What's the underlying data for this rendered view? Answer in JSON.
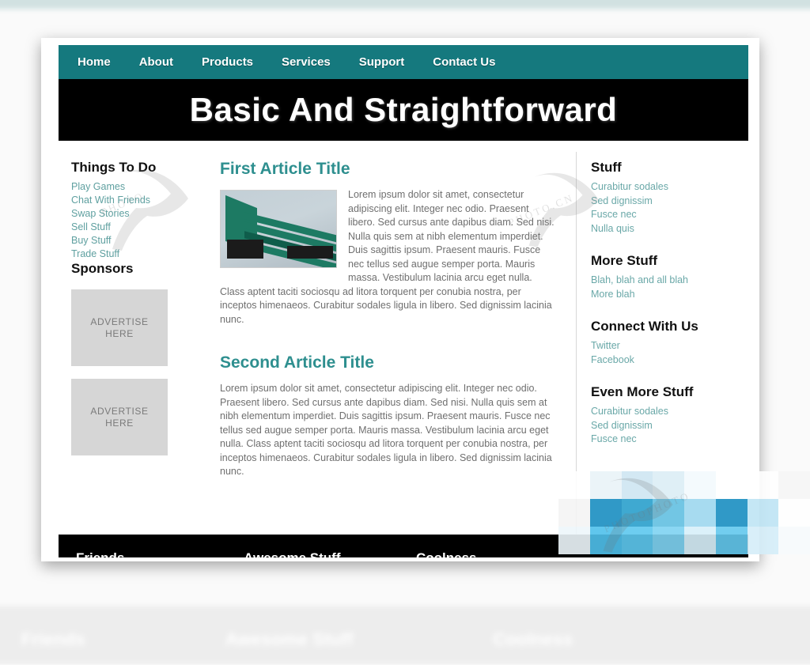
{
  "nav": {
    "items": [
      {
        "label": "Home"
      },
      {
        "label": "About"
      },
      {
        "label": "Products"
      },
      {
        "label": "Services"
      },
      {
        "label": "Support"
      },
      {
        "label": "Contact Us"
      }
    ]
  },
  "hero": {
    "title": "Basic And Straightforward"
  },
  "sidebar_left": {
    "things_heading": "Things To Do",
    "things_items": [
      "Play Games",
      "Chat With Friends",
      "Swap Stories",
      "Sell Stuff",
      "Buy Stuff",
      "Trade Stuff"
    ],
    "sponsors_heading": "Sponsors",
    "ads": [
      {
        "line1": "ADVERTISE",
        "line2": "HERE"
      },
      {
        "line1": "ADVERTISE",
        "line2": "HERE"
      }
    ]
  },
  "main": {
    "articles": [
      {
        "title": "First Article Title",
        "image_alt": "green-bench-photo",
        "body": "Lorem ipsum dolor sit amet, consectetur adipiscing elit. Integer nec odio. Praesent libero. Sed cursus ante dapibus diam. Sed nisi. Nulla quis sem at nibh elementum imperdiet. Duis sagittis ipsum. Praesent mauris. Fusce nec tellus sed augue semper porta. Mauris massa. Vestibulum lacinia arcu eget nulla. Class aptent taciti sociosqu ad litora torquent per conubia nostra, per inceptos himenaeos. Curabitur sodales ligula in libero. Sed dignissim lacinia nunc."
      },
      {
        "title": "Second Article Title",
        "body": "Lorem ipsum dolor sit amet, consectetur adipiscing elit. Integer nec odio. Praesent libero. Sed cursus ante dapibus diam. Sed nisi. Nulla quis sem at nibh elementum imperdiet. Duis sagittis ipsum. Praesent mauris. Fusce nec tellus sed augue semper porta. Mauris massa. Vestibulum lacinia arcu eget nulla. Class aptent taciti sociosqu ad litora torquent per conubia nostra, per inceptos himenaeos. Curabitur sodales ligula in libero. Sed dignissim lacinia nunc."
      }
    ]
  },
  "sidebar_right": {
    "sections": [
      {
        "heading": "Stuff",
        "items": [
          "Curabitur sodales",
          "Sed dignissim",
          "Fusce nec",
          "Nulla quis"
        ]
      },
      {
        "heading": "More Stuff",
        "items": [
          "Blah, blah and all blah",
          "More blah"
        ]
      },
      {
        "heading": "Connect With Us",
        "items": [
          "Twitter",
          "Facebook"
        ]
      },
      {
        "heading": "Even More Stuff",
        "items": [
          "Curabitur sodales",
          "Sed dignissim",
          "Fusce nec"
        ]
      }
    ]
  },
  "footer": {
    "columns": [
      "Friends",
      "Awesome Stuff",
      "Coolness"
    ]
  },
  "watermark": {
    "text_a": "PHOTO",
    "text_b": "PHOTO.CN",
    "text_c": "PHOTOPHOTO"
  },
  "colors": {
    "nav_teal": "#15797e",
    "hero_black": "#000000",
    "article_title_teal": "#2e8f8f",
    "link_teal": "#6aa8a8",
    "ad_gray": "#d6d6d6",
    "footer_black": "#000000",
    "mosaic_blue": "#1a8fc1"
  },
  "mosaic_tiles": [
    "#ffffff",
    "#e9f3f8",
    "#cfe6f2",
    "#dceef6",
    "#f3fafd",
    "#ffffff",
    "#ffffff",
    "#f6f6f6",
    "#f4f4f4",
    "#1a8fc1",
    "#2ba0cd",
    "#63c0e2",
    "#9ed8ef",
    "#1a8fc1",
    "#bfe5f5",
    "#ffffff",
    "#eef7fb",
    "#4fc0ec",
    "#5ec8ef",
    "#7fd3f2",
    "#d8f0fa",
    "#63c8ee",
    "#d5eef9",
    "#f7fbfd"
  ]
}
